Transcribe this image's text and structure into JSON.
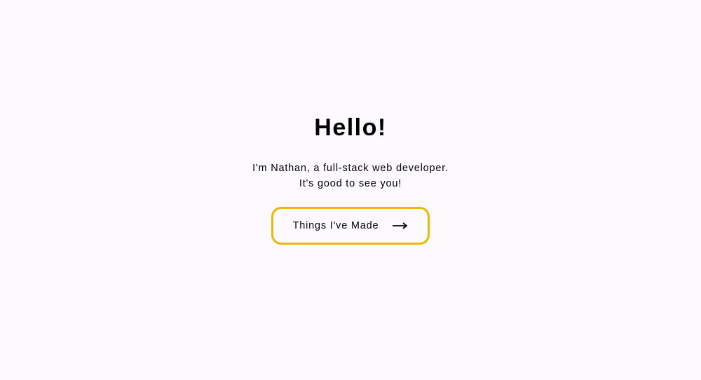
{
  "hero": {
    "title": "Hello!",
    "subtitle_line1": "I'm Nathan, a full-stack web developer.",
    "subtitle_line2": "It's good to see you!",
    "cta_label": "Things I've Made"
  },
  "colors": {
    "accent": "#eeb609",
    "background": "#fdfafd",
    "text": "#000000"
  }
}
